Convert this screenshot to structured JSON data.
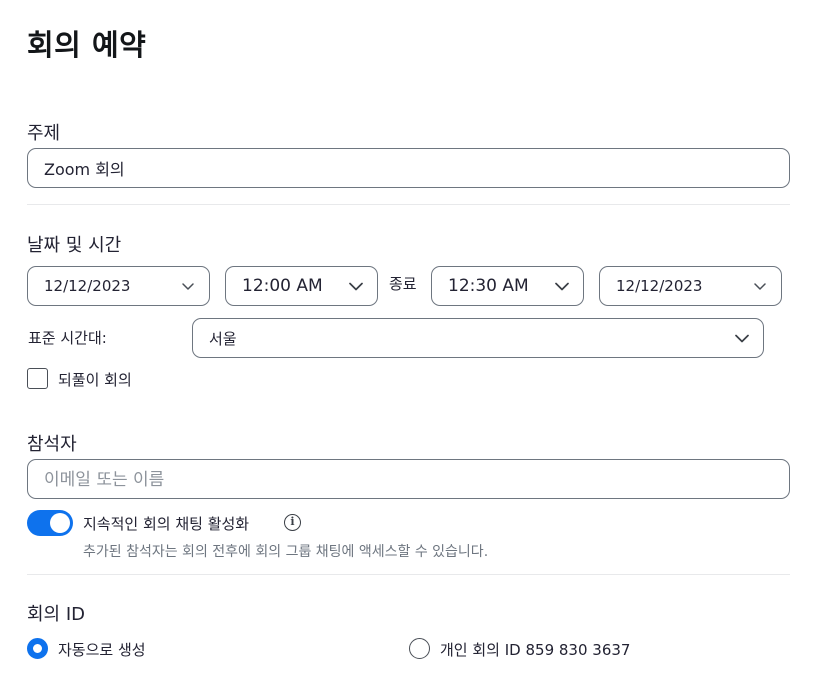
{
  "page": {
    "title": "회의 예약"
  },
  "topic": {
    "label": "주제",
    "value": "Zoom 회의"
  },
  "datetime": {
    "label": "날짜 및 시간",
    "start_date": "12/12/2023",
    "start_time": "12:00 AM",
    "end_label": "종료",
    "end_time": "12:30 AM",
    "end_date": "12/12/2023",
    "timezone_label": "표준 시간대:",
    "timezone_value": "서울",
    "recurring_label": "되풀이 회의",
    "recurring_checked": false
  },
  "attendees": {
    "label": "참석자",
    "placeholder": "이메일 또는 이름",
    "continuous_chat_label": "지속적인 회의 채팅 활성화",
    "continuous_chat_enabled": true,
    "hint": "추가된 참석자는 회의 전후에 회의 그룹 채팅에 액세스할 수 있습니다."
  },
  "meeting_id": {
    "label": "회의 ID",
    "auto_label": "자동으로 생성",
    "personal_label": "개인 회의 ID 859 830 3637",
    "selected": "auto"
  },
  "colors": {
    "accent": "#0e72ed",
    "border": "#6e7680",
    "hint": "#6e7680"
  },
  "icons": {
    "dropdown": "chevron-down-icon",
    "info": "info-icon"
  }
}
